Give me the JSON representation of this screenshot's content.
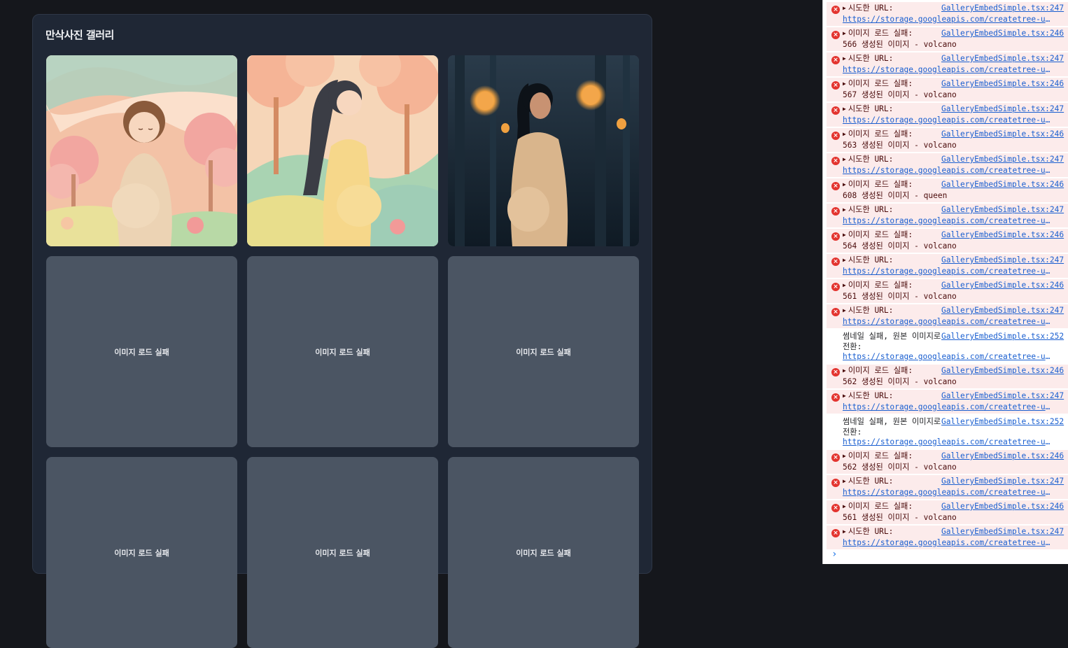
{
  "gallery": {
    "title": "만삭사진 갤러리",
    "fail_label": "이미지 로드 실패",
    "images": [
      {
        "status": "loaded",
        "icon": "papercraft-pregnant-woman-pink-trees"
      },
      {
        "status": "loaded",
        "icon": "papercraft-pregnant-woman-yellow-dress"
      },
      {
        "status": "loaded",
        "icon": "pregnant-woman-lantern-forest-photo"
      },
      {
        "status": "failed"
      },
      {
        "status": "failed"
      },
      {
        "status": "failed"
      },
      {
        "status": "failed"
      },
      {
        "status": "failed"
      },
      {
        "status": "failed"
      }
    ]
  },
  "console": {
    "messages": [
      {
        "level": "error",
        "text": "시도한 URL:",
        "source": "GalleryEmbedSimple.tsx:247",
        "line2": "https://storage.googleapis.com/createtree-upload…",
        "line2_is_link": true
      },
      {
        "level": "error",
        "text": "이미지 로드 실패:",
        "source": "GalleryEmbedSimple.tsx:246",
        "line2": "566 생성된 이미지 - volcano",
        "line2_is_link": false
      },
      {
        "level": "error",
        "text": "시도한 URL:",
        "source": "GalleryEmbedSimple.tsx:247",
        "line2": "https://storage.googleapis.com/createtree-upload…",
        "line2_is_link": true
      },
      {
        "level": "error",
        "text": "이미지 로드 실패:",
        "source": "GalleryEmbedSimple.tsx:246",
        "line2": "567 생성된 이미지 - volcano",
        "line2_is_link": false
      },
      {
        "level": "error",
        "text": "시도한 URL:",
        "source": "GalleryEmbedSimple.tsx:247",
        "line2": "https://storage.googleapis.com/createtree-upload…",
        "line2_is_link": true
      },
      {
        "level": "error",
        "text": "이미지 로드 실패:",
        "source": "GalleryEmbedSimple.tsx:246",
        "line2": "563 생성된 이미지 - volcano",
        "line2_is_link": false
      },
      {
        "level": "error",
        "text": "시도한 URL:",
        "source": "GalleryEmbedSimple.tsx:247",
        "line2": "https://storage.googleapis.com/createtree-upload…",
        "line2_is_link": true
      },
      {
        "level": "error",
        "text": "이미지 로드 실패:",
        "source": "GalleryEmbedSimple.tsx:246",
        "line2": "608 생성된 이미지 - queen",
        "line2_is_link": false
      },
      {
        "level": "error",
        "text": "시도한 URL:",
        "source": "GalleryEmbedSimple.tsx:247",
        "line2": "https://storage.googleapis.com/createtree-upload…",
        "line2_is_link": true
      },
      {
        "level": "error",
        "text": "이미지 로드 실패:",
        "source": "GalleryEmbedSimple.tsx:246",
        "line2": "564 생성된 이미지 - volcano",
        "line2_is_link": false
      },
      {
        "level": "error",
        "text": "시도한 URL:",
        "source": "GalleryEmbedSimple.tsx:247",
        "line2": "https://storage.googleapis.com/createtree-upload…",
        "line2_is_link": true
      },
      {
        "level": "error",
        "text": "이미지 로드 실패:",
        "source": "GalleryEmbedSimple.tsx:246",
        "line2": "561 생성된 이미지 - volcano",
        "line2_is_link": false
      },
      {
        "level": "error",
        "text": "시도한 URL:",
        "source": "GalleryEmbedSimple.tsx:247",
        "line2": "https://storage.googleapis.com/createtree-upload…",
        "line2_is_link": true
      },
      {
        "level": "log",
        "text": "썸네일 실패, 원본 이미지로 전환:",
        "source": "GalleryEmbedSimple.tsx:252",
        "line2": "https://storage.googleapis.com/createtree-upload…",
        "line2_is_link": true
      },
      {
        "level": "error",
        "text": "이미지 로드 실패:",
        "source": "GalleryEmbedSimple.tsx:246",
        "line2": "562 생성된 이미지 - volcano",
        "line2_is_link": false
      },
      {
        "level": "error",
        "text": "시도한 URL:",
        "source": "GalleryEmbedSimple.tsx:247",
        "line2": "https://storage.googleapis.com/createtree-upload…",
        "line2_is_link": true
      },
      {
        "level": "log",
        "text": "썸네일 실패, 원본 이미지로 전환:",
        "source": "GalleryEmbedSimple.tsx:252",
        "line2": "https://storage.googleapis.com/createtree-upload…",
        "line2_is_link": true
      },
      {
        "level": "error",
        "text": "이미지 로드 실패:",
        "source": "GalleryEmbedSimple.tsx:246",
        "line2": "562 생성된 이미지 - volcano",
        "line2_is_link": false
      },
      {
        "level": "error",
        "text": "시도한 URL:",
        "source": "GalleryEmbedSimple.tsx:247",
        "line2": "https://storage.googleapis.com/createtree-upload…",
        "line2_is_link": true
      },
      {
        "level": "error",
        "text": "이미지 로드 실패:",
        "source": "GalleryEmbedSimple.tsx:246",
        "line2": "561 생성된 이미지 - volcano",
        "line2_is_link": false
      },
      {
        "level": "error",
        "text": "시도한 URL:",
        "source": "GalleryEmbedSimple.tsx:247",
        "line2": "https://storage.googleapis.com/createtree-upload…",
        "line2_is_link": true
      }
    ],
    "prompt_icon": "chevron-right-icon"
  },
  "colors": {
    "page_bg": "#15171c",
    "panel_bg": "#1f2735",
    "failed_tile_bg": "#4b5563",
    "error_row_bg": "#fcebeb",
    "error_icon": "#e3342f",
    "link": "#1a5fd0"
  }
}
